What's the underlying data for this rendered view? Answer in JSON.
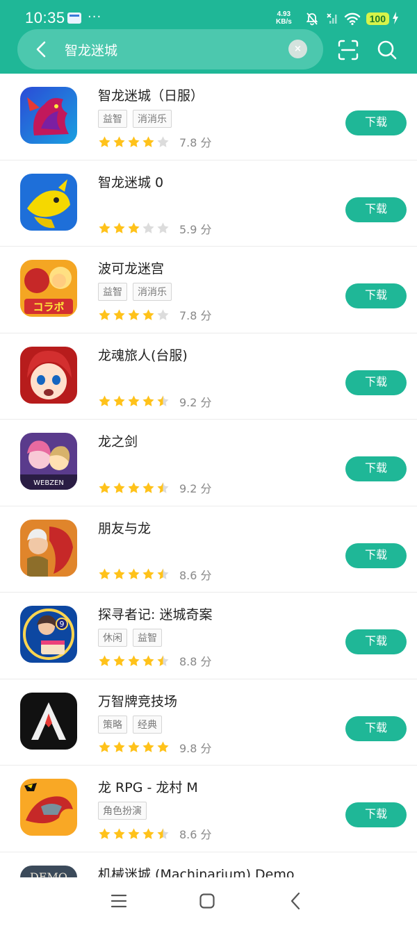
{
  "status_bar": {
    "time": "10:35",
    "dots": "···",
    "net_speed_value": "4.93",
    "net_speed_unit": "KB/s",
    "battery": "100"
  },
  "search": {
    "query": "智龙迷城",
    "clear_label": "×"
  },
  "apps": [
    {
      "name": "智龙迷城（日服）",
      "tags": [
        "益智",
        "消消乐"
      ],
      "rating": 4,
      "score": "7.8 分",
      "download_label": "下载",
      "icon": "purple-dragon"
    },
    {
      "name": "智龙迷城 0",
      "tags": [],
      "rating": 3,
      "score": "5.9 分",
      "download_label": "下载",
      "icon": "yellow-dragon"
    },
    {
      "name": "波可龙迷宫",
      "tags": [
        "益智",
        "消消乐"
      ],
      "rating": 4,
      "score": "7.8 分",
      "download_label": "下载",
      "icon": "collab-art"
    },
    {
      "name": "龙魂旅人(台服)",
      "tags": [],
      "rating": 4.5,
      "score": "9.2 分",
      "download_label": "下载",
      "icon": "red-hair-girl"
    },
    {
      "name": "龙之剑",
      "tags": [],
      "rating": 4.5,
      "score": "9.2 分",
      "download_label": "下载",
      "icon": "webzen-girls",
      "icon_text": "WEBZEN"
    },
    {
      "name": "朋友与龙",
      "tags": [],
      "rating": 4.5,
      "score": "8.6 分",
      "download_label": "下载",
      "icon": "red-dragon-hero"
    },
    {
      "name": "探寻者记: 迷城奇案",
      "tags": [
        "休闲",
        "益智"
      ],
      "rating": 4.5,
      "score": "8.8 分",
      "download_label": "下载",
      "icon": "woman-cake"
    },
    {
      "name": "万智牌竞技场",
      "tags": [
        "策略",
        "经典"
      ],
      "rating": 5,
      "score": "9.8 分",
      "download_label": "下载",
      "icon": "mtg-logo"
    },
    {
      "name": "龙 RPG - 龙村 M",
      "tags": [
        "角色扮演"
      ],
      "rating": 4.5,
      "score": "8.6 分",
      "download_label": "下载",
      "icon": "robot-dragon"
    },
    {
      "name": "机械迷城 (Machinarium) Demo",
      "tags": [],
      "rating": 0,
      "score": "",
      "download_label": "",
      "icon": "machinarium",
      "icon_text": "DEMO"
    }
  ],
  "colors": {
    "brand": "#1fb797",
    "search_box": "#4cc8ae",
    "star": "#ffc21a",
    "star_empty": "#dcdcdc"
  },
  "icons": {
    "back": "chevron-left-icon",
    "scan": "scan-icon",
    "search": "search-icon",
    "nav_menu": "menu-icon",
    "nav_home": "home-icon",
    "nav_back": "back-icon"
  }
}
